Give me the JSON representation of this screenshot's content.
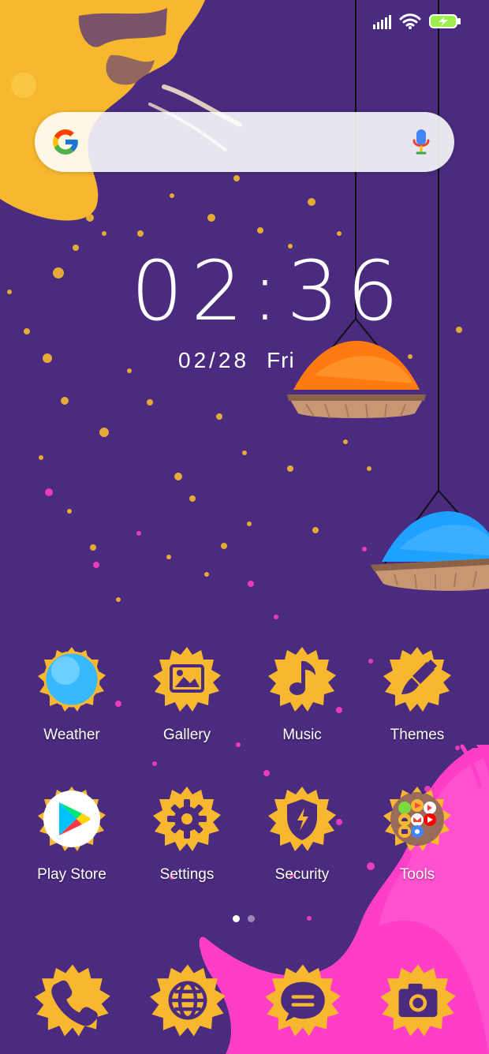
{
  "status_bar": {
    "signal_icon": "signal-icon",
    "wifi_icon": "wifi-icon",
    "battery_icon": "battery-charging-icon"
  },
  "search": {
    "placeholder": "",
    "google_icon": "google-icon",
    "mic_icon": "mic-icon"
  },
  "clock": {
    "time": "02:36",
    "date": "02/28",
    "day": "Fri"
  },
  "apps": {
    "weather": {
      "label": "Weather",
      "icon": "weather-icon"
    },
    "gallery": {
      "label": "Gallery",
      "icon": "gallery-icon"
    },
    "music": {
      "label": "Music",
      "icon": "music-icon"
    },
    "themes": {
      "label": "Themes",
      "icon": "paintbrush-icon"
    },
    "play_store": {
      "label": "Play Store",
      "icon": "play-store-icon"
    },
    "settings": {
      "label": "Settings",
      "icon": "gear-icon"
    },
    "security": {
      "label": "Security",
      "icon": "shield-icon"
    },
    "tools": {
      "label": "Tools",
      "icon": "folder-icon"
    }
  },
  "page_indicator": {
    "current": 1,
    "total": 2
  },
  "dock": [
    {
      "name": "Phone",
      "icon": "phone-icon"
    },
    {
      "name": "Browser",
      "icon": "globe-icon"
    },
    {
      "name": "Messages",
      "icon": "message-icon"
    },
    {
      "name": "Camera",
      "icon": "camera-icon"
    }
  ],
  "colors": {
    "background": "#4a2b7f",
    "yellow": "#f7b830",
    "magenta": "#ff3ec7",
    "orange": "#ff7a10",
    "blue": "#1ea1ff",
    "bowl": "#b98c6a"
  }
}
